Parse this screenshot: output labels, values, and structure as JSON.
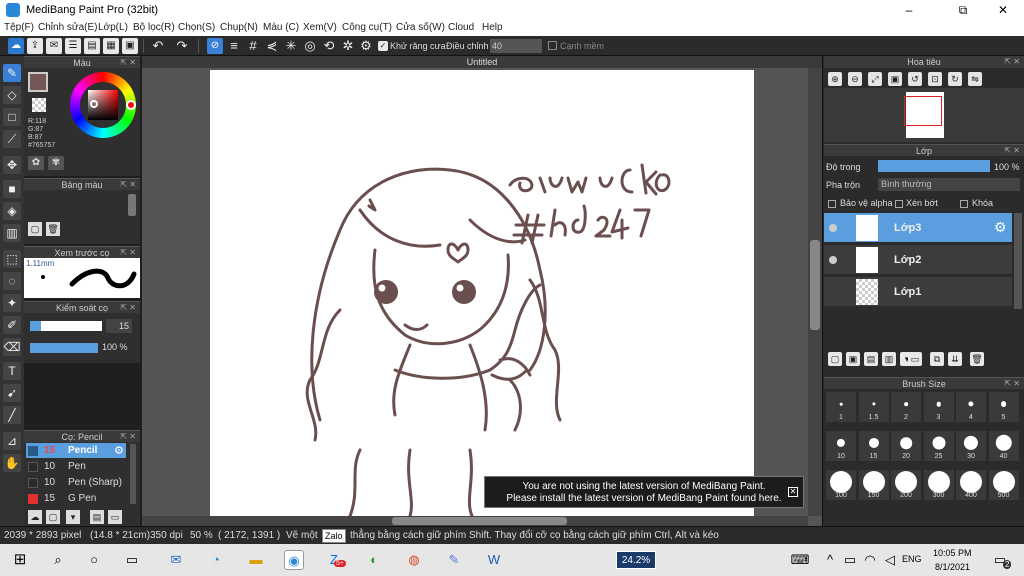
{
  "window": {
    "title": "MediBang Paint Pro (32bit)",
    "min": "–",
    "max": "⧉",
    "close": "✕"
  },
  "menu": [
    "Tệp(F)",
    "Chỉnh sửa(E)",
    "Lớp(L)",
    "Bộ lọc(R)",
    "Chọn(S)",
    "Chụp(N)",
    "Màu (C)",
    "Xem(V)",
    "Công cụ(T)",
    "Cửa số(W)",
    "Cloud",
    "Help"
  ],
  "toolbar": {
    "antialias": "Khử răng cưa",
    "adjust_label": "Điều chỉnh",
    "adjust_value": "40",
    "smooth": "Cạnh mềm"
  },
  "color_panel": {
    "title": "Màu",
    "r": "R:118",
    "g": "G:87",
    "b": "B:87",
    "hex": "#765757",
    "fg": "#765757"
  },
  "palette_panel": {
    "title": "Bảng màu"
  },
  "preview_panel": {
    "title": "Xem trước cọ",
    "size": "1.11mm"
  },
  "brush_control": {
    "title": "Kiểm soát cọ",
    "size": "15",
    "size_frac": 0.15,
    "opacity": "100 %",
    "opacity_frac": 1.0
  },
  "brush_list": {
    "title": "Cọ: Pencil",
    "items": [
      {
        "size": "15",
        "name": "Pencil",
        "color": "#2a5a8a",
        "active": true
      },
      {
        "size": "10",
        "name": "Pen",
        "color": "#2a2a2a",
        "active": false
      },
      {
        "size": "10",
        "name": "Pen (Sharp)",
        "color": "#2a2a2a",
        "active": false
      },
      {
        "size": "15",
        "name": "G Pen",
        "color": "#e03030",
        "active": false
      }
    ]
  },
  "document": {
    "tab": "Untitled",
    "sign_line1": "@mumu CKno",
    "sign_line2": "#hd247"
  },
  "notice": {
    "line1": "You are not using the latest version of MediBang Paint.",
    "line2": "Please install the latest version of MediBang Paint found here.",
    "close": "✕"
  },
  "navigator": {
    "title": "Hoa tiêu"
  },
  "layer_panel": {
    "title": "Lớp",
    "opacity_label": "Độ trong",
    "opacity_value": "100 %",
    "blend_label": "Pha trộn",
    "blend_value": "Bình thường",
    "alpha": "Bảo vệ alpha",
    "clip": "Xén bớt",
    "lock": "Khóa",
    "layers": [
      {
        "name": "Lớp3",
        "active": true
      },
      {
        "name": "Lớp2",
        "active": false
      },
      {
        "name": "Lớp1",
        "active": false
      }
    ]
  },
  "brush_size": {
    "title": "Brush Size",
    "sizes": [
      "1",
      "1.5",
      "2",
      "3",
      "4",
      "5",
      "10",
      "15",
      "20",
      "25",
      "30",
      "40",
      "100",
      "150",
      "200",
      "300",
      "400",
      "500"
    ]
  },
  "status": {
    "dims": "2039 * 2893 pixel",
    "cm": "(14.8 * 21cm)",
    "dpi": "350 dpi",
    "zoom": "50 %",
    "coords": "( 2172, 1391 )",
    "hint_a": "Vẽ một",
    "hint_b": "thẳng bằng cách giữ phím Shift. Thay đổi cỡ cọ bằng cách giữ phím Ctrl, Alt và kéo",
    "tooltip": "Zalo"
  },
  "taskbar": {
    "zalo_badge": "5+",
    "battery": "24.2%",
    "lang": "ENG",
    "time": "10:05 PM",
    "date": "8/1/2021",
    "notif": "2"
  }
}
